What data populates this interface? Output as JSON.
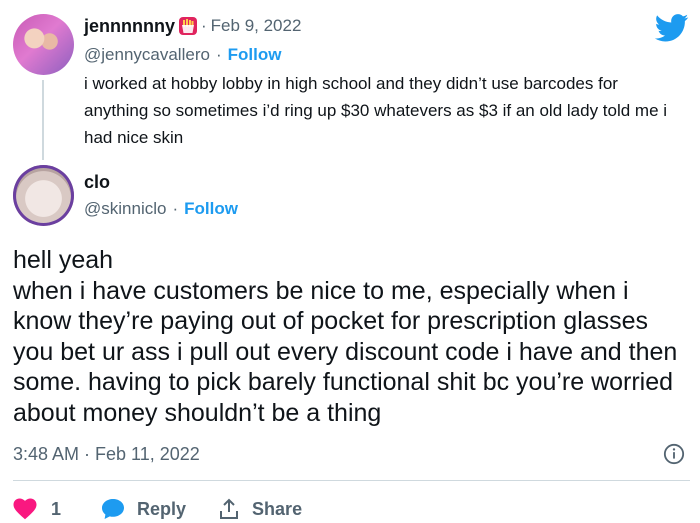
{
  "quoted_tweet": {
    "display_name": "jennnnnny",
    "date": "Feb 9, 2022",
    "handle": "@jennycavallero",
    "follow_label": "Follow",
    "text": "i worked at hobby lobby in high school and they didn’t use barcodes for anything so sometimes i’d ring up $30 whatevers as $3 if an old lady told me i had nice skin"
  },
  "main_tweet": {
    "display_name": "clo",
    "handle": "@skinniclo",
    "follow_label": "Follow",
    "text_lines": [
      "hell yeah",
      "when i have customers be nice to me, especially when i know they’re paying out of pocket for prescription glasses you bet ur ass i pull out every discount code i have and then some. having to pick barely functional shit bc you’re worried about money shouldn’t be a thing"
    ],
    "timestamp": "3:48 AM · Feb 11, 2022"
  },
  "actions": {
    "like_count": "1",
    "reply_label": "Reply",
    "share_label": "Share"
  },
  "colors": {
    "accent": "#1d9bf0",
    "like": "#f91880",
    "muted": "#536471",
    "text": "#0f1419"
  },
  "icons": {
    "brand": "twitter-bird-icon",
    "info": "info-icon",
    "like": "heart-icon",
    "reply": "speech-bubble-icon",
    "share": "share-upload-icon",
    "name_emoji": "fries-emoji-icon"
  }
}
